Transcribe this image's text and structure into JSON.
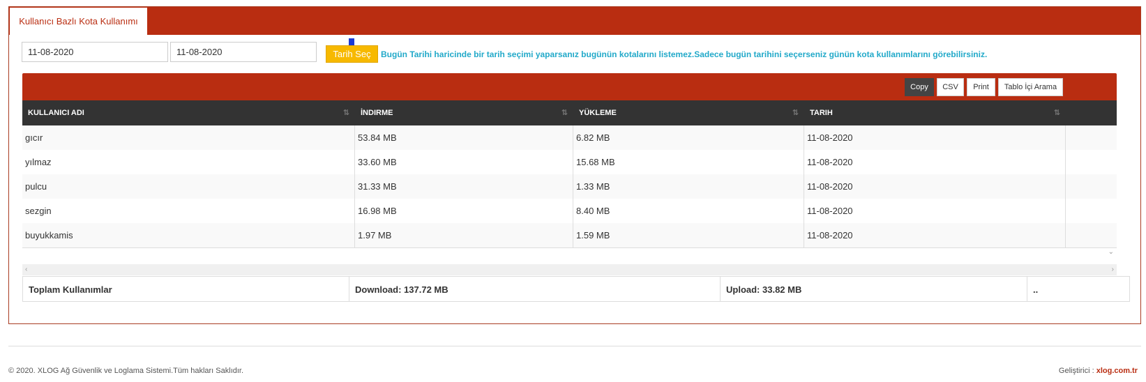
{
  "tab": {
    "label": "Kullanıcı Bazlı Kota Kullanımı"
  },
  "filters": {
    "start_date": "11-08-2020",
    "end_date": "11-08-2020",
    "select_button": "Tarih Seç",
    "info": "Bugün Tarihi haricinde bir tarih seçimi yaparsanız bugünün kotalarını listemez.Sadece bugün tarihini seçerseniz günün kota kullanımlarını görebilirsiniz."
  },
  "toolbar": {
    "copy": "Copy",
    "csv": "CSV",
    "print": "Print",
    "search": "Tablo İçi Arama"
  },
  "table": {
    "headers": [
      "KULLANICI ADI",
      "İNDIRME",
      "YÜKLEME",
      "TARIH"
    ],
    "rows": [
      [
        "gıcır",
        "53.84 MB",
        "6.82 MB",
        "11-08-2020"
      ],
      [
        "yılmaz",
        "33.60 MB",
        "15.68 MB",
        "11-08-2020"
      ],
      [
        "pulcu",
        "31.33 MB",
        "1.33 MB",
        "11-08-2020"
      ],
      [
        "sezgin",
        "16.98 MB",
        "8.40 MB",
        "11-08-2020"
      ],
      [
        "buyukkamis",
        "1.97 MB",
        "1.59 MB",
        "11-08-2020"
      ]
    ]
  },
  "totals": {
    "label": "Toplam Kullanımlar",
    "download": "Download: 137.72 MB",
    "upload": "Upload: 33.82 MB",
    "extra": ".."
  },
  "footer": {
    "copyright": "© 2020. XLOG Ağ Güvenlik ve Loglama Sistemi.Tüm hakları Saklıdır.",
    "developer_prefix": "Geliştirici : ",
    "developer_link": "xlog.com.tr"
  },
  "colors": {
    "brand": "#b92d11",
    "accent_button": "#f7b900",
    "info_text": "#22a9c9",
    "table_header": "#333333"
  },
  "icons": {
    "arrow": "arrow-down-icon",
    "sort": "sort-icon",
    "scroll_down": "chevron-down-icon",
    "scroll_left": "chevron-left-icon",
    "scroll_right": "chevron-right-icon"
  }
}
